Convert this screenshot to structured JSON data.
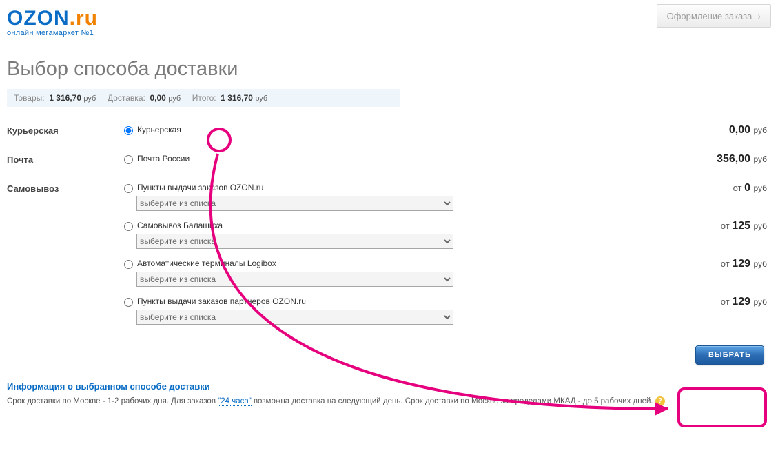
{
  "header": {
    "logo_main_a": "OZON",
    "logo_main_b": ".ru",
    "logo_sub": "онлайн мегамаркет №1",
    "step_label": "Оформление заказа"
  },
  "title": "Выбор способа доставки",
  "summary": {
    "goods_label": "Товары:",
    "goods_value": "1 316,70",
    "delivery_label": "Доставка:",
    "delivery_value": "0,00",
    "total_label": "Итого:",
    "total_value": "1 316,70",
    "rub": "руб"
  },
  "sections": {
    "courier": {
      "label": "Курьерская",
      "option": "Курьерская",
      "price": "0,00"
    },
    "post": {
      "label": "Почта",
      "option": "Почта России",
      "price": "356,00"
    },
    "pickup": {
      "label": "Самовывоз",
      "options": [
        {
          "name": "Пункты выдачи заказов OZON.ru",
          "price_prefix": "от ",
          "price": "0",
          "select_placeholder": "выберите из списка"
        },
        {
          "name": "Самовывоз Балашиха",
          "price_prefix": "от ",
          "price": "125",
          "select_placeholder": "выберите из списка"
        },
        {
          "name": "Автоматические терминалы Logibox",
          "price_prefix": "от ",
          "price": "129",
          "select_placeholder": "выберите из списка"
        },
        {
          "name": "Пункты выдачи заказов партнеров OZON.ru",
          "price_prefix": "от ",
          "price": "129",
          "select_placeholder": "выберите из списка"
        }
      ]
    }
  },
  "rub": "руб",
  "button_select": "ВЫБРАТЬ",
  "info": {
    "title": "Информация о выбранном способе доставки",
    "text_a": "Срок доставки по Москве - 1-2 рабочих дня. Для заказов ",
    "link": "\"24 часа\"",
    "text_b": " возможна доставка на следующий день. Срок доставки по Москве за пределами МКАД - до 5 рабочих дней."
  }
}
